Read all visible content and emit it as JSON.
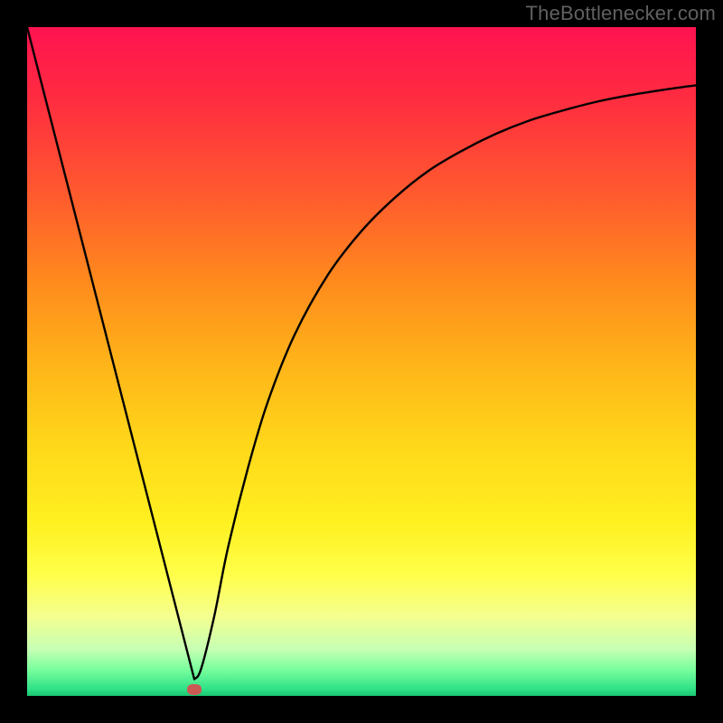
{
  "attribution": "TheBottlenecker.com",
  "colors": {
    "frame": "#000000",
    "attribution_text": "#606060",
    "curve_stroke": "#000000",
    "marker_fill": "#cc5a54",
    "gradient_stops": [
      {
        "pos": 0,
        "color": "#ff1350"
      },
      {
        "pos": 10,
        "color": "#ff2a41"
      },
      {
        "pos": 25,
        "color": "#ff5a2e"
      },
      {
        "pos": 38,
        "color": "#ff8a1d"
      },
      {
        "pos": 50,
        "color": "#ffb319"
      },
      {
        "pos": 62,
        "color": "#ffd61a"
      },
      {
        "pos": 74,
        "color": "#fff020"
      },
      {
        "pos": 82,
        "color": "#ffff4a"
      },
      {
        "pos": 88,
        "color": "#f5ff8e"
      },
      {
        "pos": 93,
        "color": "#c7ffb4"
      },
      {
        "pos": 96,
        "color": "#7aff9d"
      },
      {
        "pos": 99,
        "color": "#2fe187"
      },
      {
        "pos": 100,
        "color": "#18c772"
      }
    ]
  },
  "chart_data": {
    "type": "line",
    "title": "",
    "xlabel": "",
    "ylabel": "",
    "xlim": [
      0,
      100
    ],
    "ylim": [
      0,
      100
    ],
    "annotations": [],
    "marker": {
      "x": 25,
      "y": 1
    },
    "series": [
      {
        "name": "bottleneck-curve",
        "x": [
          0,
          5,
          10,
          15,
          20,
          22,
          24,
          25,
          26,
          28,
          30,
          33,
          36,
          40,
          45,
          50,
          55,
          60,
          65,
          70,
          75,
          80,
          85,
          90,
          95,
          100
        ],
        "y": [
          100,
          80.5,
          61,
          41.5,
          22,
          14.2,
          6.4,
          2.5,
          4,
          12,
          22,
          34,
          44,
          54,
          63,
          69.5,
          74.5,
          78.5,
          81.5,
          84,
          86,
          87.5,
          88.8,
          89.8,
          90.6,
          91.3
        ]
      }
    ]
  }
}
